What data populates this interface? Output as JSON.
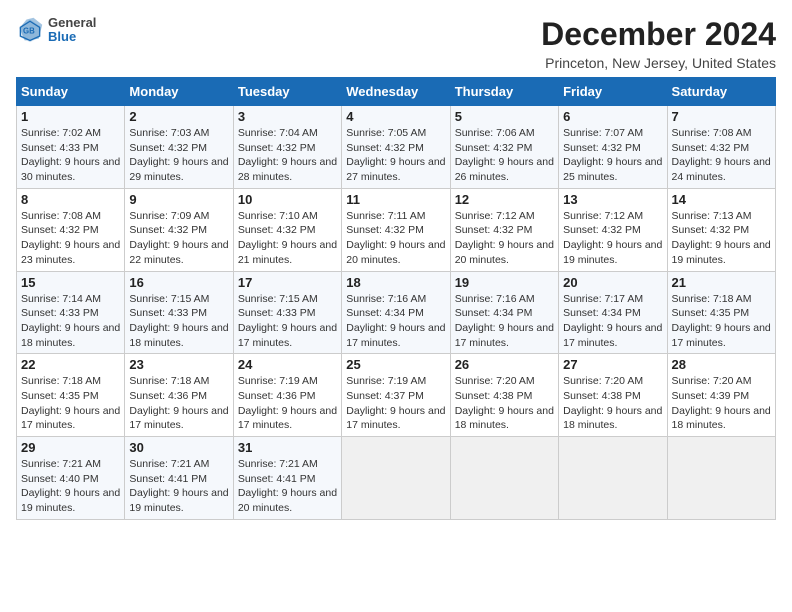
{
  "header": {
    "logo_general": "General",
    "logo_blue": "Blue",
    "title": "December 2024",
    "location": "Princeton, New Jersey, United States"
  },
  "weekdays": [
    "Sunday",
    "Monday",
    "Tuesday",
    "Wednesday",
    "Thursday",
    "Friday",
    "Saturday"
  ],
  "weeks": [
    [
      {
        "day": "1",
        "sunrise": "7:02 AM",
        "sunset": "4:33 PM",
        "daylight": "9 hours and 30 minutes."
      },
      {
        "day": "2",
        "sunrise": "7:03 AM",
        "sunset": "4:32 PM",
        "daylight": "9 hours and 29 minutes."
      },
      {
        "day": "3",
        "sunrise": "7:04 AM",
        "sunset": "4:32 PM",
        "daylight": "9 hours and 28 minutes."
      },
      {
        "day": "4",
        "sunrise": "7:05 AM",
        "sunset": "4:32 PM",
        "daylight": "9 hours and 27 minutes."
      },
      {
        "day": "5",
        "sunrise": "7:06 AM",
        "sunset": "4:32 PM",
        "daylight": "9 hours and 26 minutes."
      },
      {
        "day": "6",
        "sunrise": "7:07 AM",
        "sunset": "4:32 PM",
        "daylight": "9 hours and 25 minutes."
      },
      {
        "day": "7",
        "sunrise": "7:08 AM",
        "sunset": "4:32 PM",
        "daylight": "9 hours and 24 minutes."
      }
    ],
    [
      {
        "day": "8",
        "sunrise": "7:08 AM",
        "sunset": "4:32 PM",
        "daylight": "9 hours and 23 minutes."
      },
      {
        "day": "9",
        "sunrise": "7:09 AM",
        "sunset": "4:32 PM",
        "daylight": "9 hours and 22 minutes."
      },
      {
        "day": "10",
        "sunrise": "7:10 AM",
        "sunset": "4:32 PM",
        "daylight": "9 hours and 21 minutes."
      },
      {
        "day": "11",
        "sunrise": "7:11 AM",
        "sunset": "4:32 PM",
        "daylight": "9 hours and 20 minutes."
      },
      {
        "day": "12",
        "sunrise": "7:12 AM",
        "sunset": "4:32 PM",
        "daylight": "9 hours and 20 minutes."
      },
      {
        "day": "13",
        "sunrise": "7:12 AM",
        "sunset": "4:32 PM",
        "daylight": "9 hours and 19 minutes."
      },
      {
        "day": "14",
        "sunrise": "7:13 AM",
        "sunset": "4:32 PM",
        "daylight": "9 hours and 19 minutes."
      }
    ],
    [
      {
        "day": "15",
        "sunrise": "7:14 AM",
        "sunset": "4:33 PM",
        "daylight": "9 hours and 18 minutes."
      },
      {
        "day": "16",
        "sunrise": "7:15 AM",
        "sunset": "4:33 PM",
        "daylight": "9 hours and 18 minutes."
      },
      {
        "day": "17",
        "sunrise": "7:15 AM",
        "sunset": "4:33 PM",
        "daylight": "9 hours and 17 minutes."
      },
      {
        "day": "18",
        "sunrise": "7:16 AM",
        "sunset": "4:34 PM",
        "daylight": "9 hours and 17 minutes."
      },
      {
        "day": "19",
        "sunrise": "7:16 AM",
        "sunset": "4:34 PM",
        "daylight": "9 hours and 17 minutes."
      },
      {
        "day": "20",
        "sunrise": "7:17 AM",
        "sunset": "4:34 PM",
        "daylight": "9 hours and 17 minutes."
      },
      {
        "day": "21",
        "sunrise": "7:18 AM",
        "sunset": "4:35 PM",
        "daylight": "9 hours and 17 minutes."
      }
    ],
    [
      {
        "day": "22",
        "sunrise": "7:18 AM",
        "sunset": "4:35 PM",
        "daylight": "9 hours and 17 minutes."
      },
      {
        "day": "23",
        "sunrise": "7:18 AM",
        "sunset": "4:36 PM",
        "daylight": "9 hours and 17 minutes."
      },
      {
        "day": "24",
        "sunrise": "7:19 AM",
        "sunset": "4:36 PM",
        "daylight": "9 hours and 17 minutes."
      },
      {
        "day": "25",
        "sunrise": "7:19 AM",
        "sunset": "4:37 PM",
        "daylight": "9 hours and 17 minutes."
      },
      {
        "day": "26",
        "sunrise": "7:20 AM",
        "sunset": "4:38 PM",
        "daylight": "9 hours and 18 minutes."
      },
      {
        "day": "27",
        "sunrise": "7:20 AM",
        "sunset": "4:38 PM",
        "daylight": "9 hours and 18 minutes."
      },
      {
        "day": "28",
        "sunrise": "7:20 AM",
        "sunset": "4:39 PM",
        "daylight": "9 hours and 18 minutes."
      }
    ],
    [
      {
        "day": "29",
        "sunrise": "7:21 AM",
        "sunset": "4:40 PM",
        "daylight": "9 hours and 19 minutes."
      },
      {
        "day": "30",
        "sunrise": "7:21 AM",
        "sunset": "4:41 PM",
        "daylight": "9 hours and 19 minutes."
      },
      {
        "day": "31",
        "sunrise": "7:21 AM",
        "sunset": "4:41 PM",
        "daylight": "9 hours and 20 minutes."
      },
      null,
      null,
      null,
      null
    ]
  ]
}
